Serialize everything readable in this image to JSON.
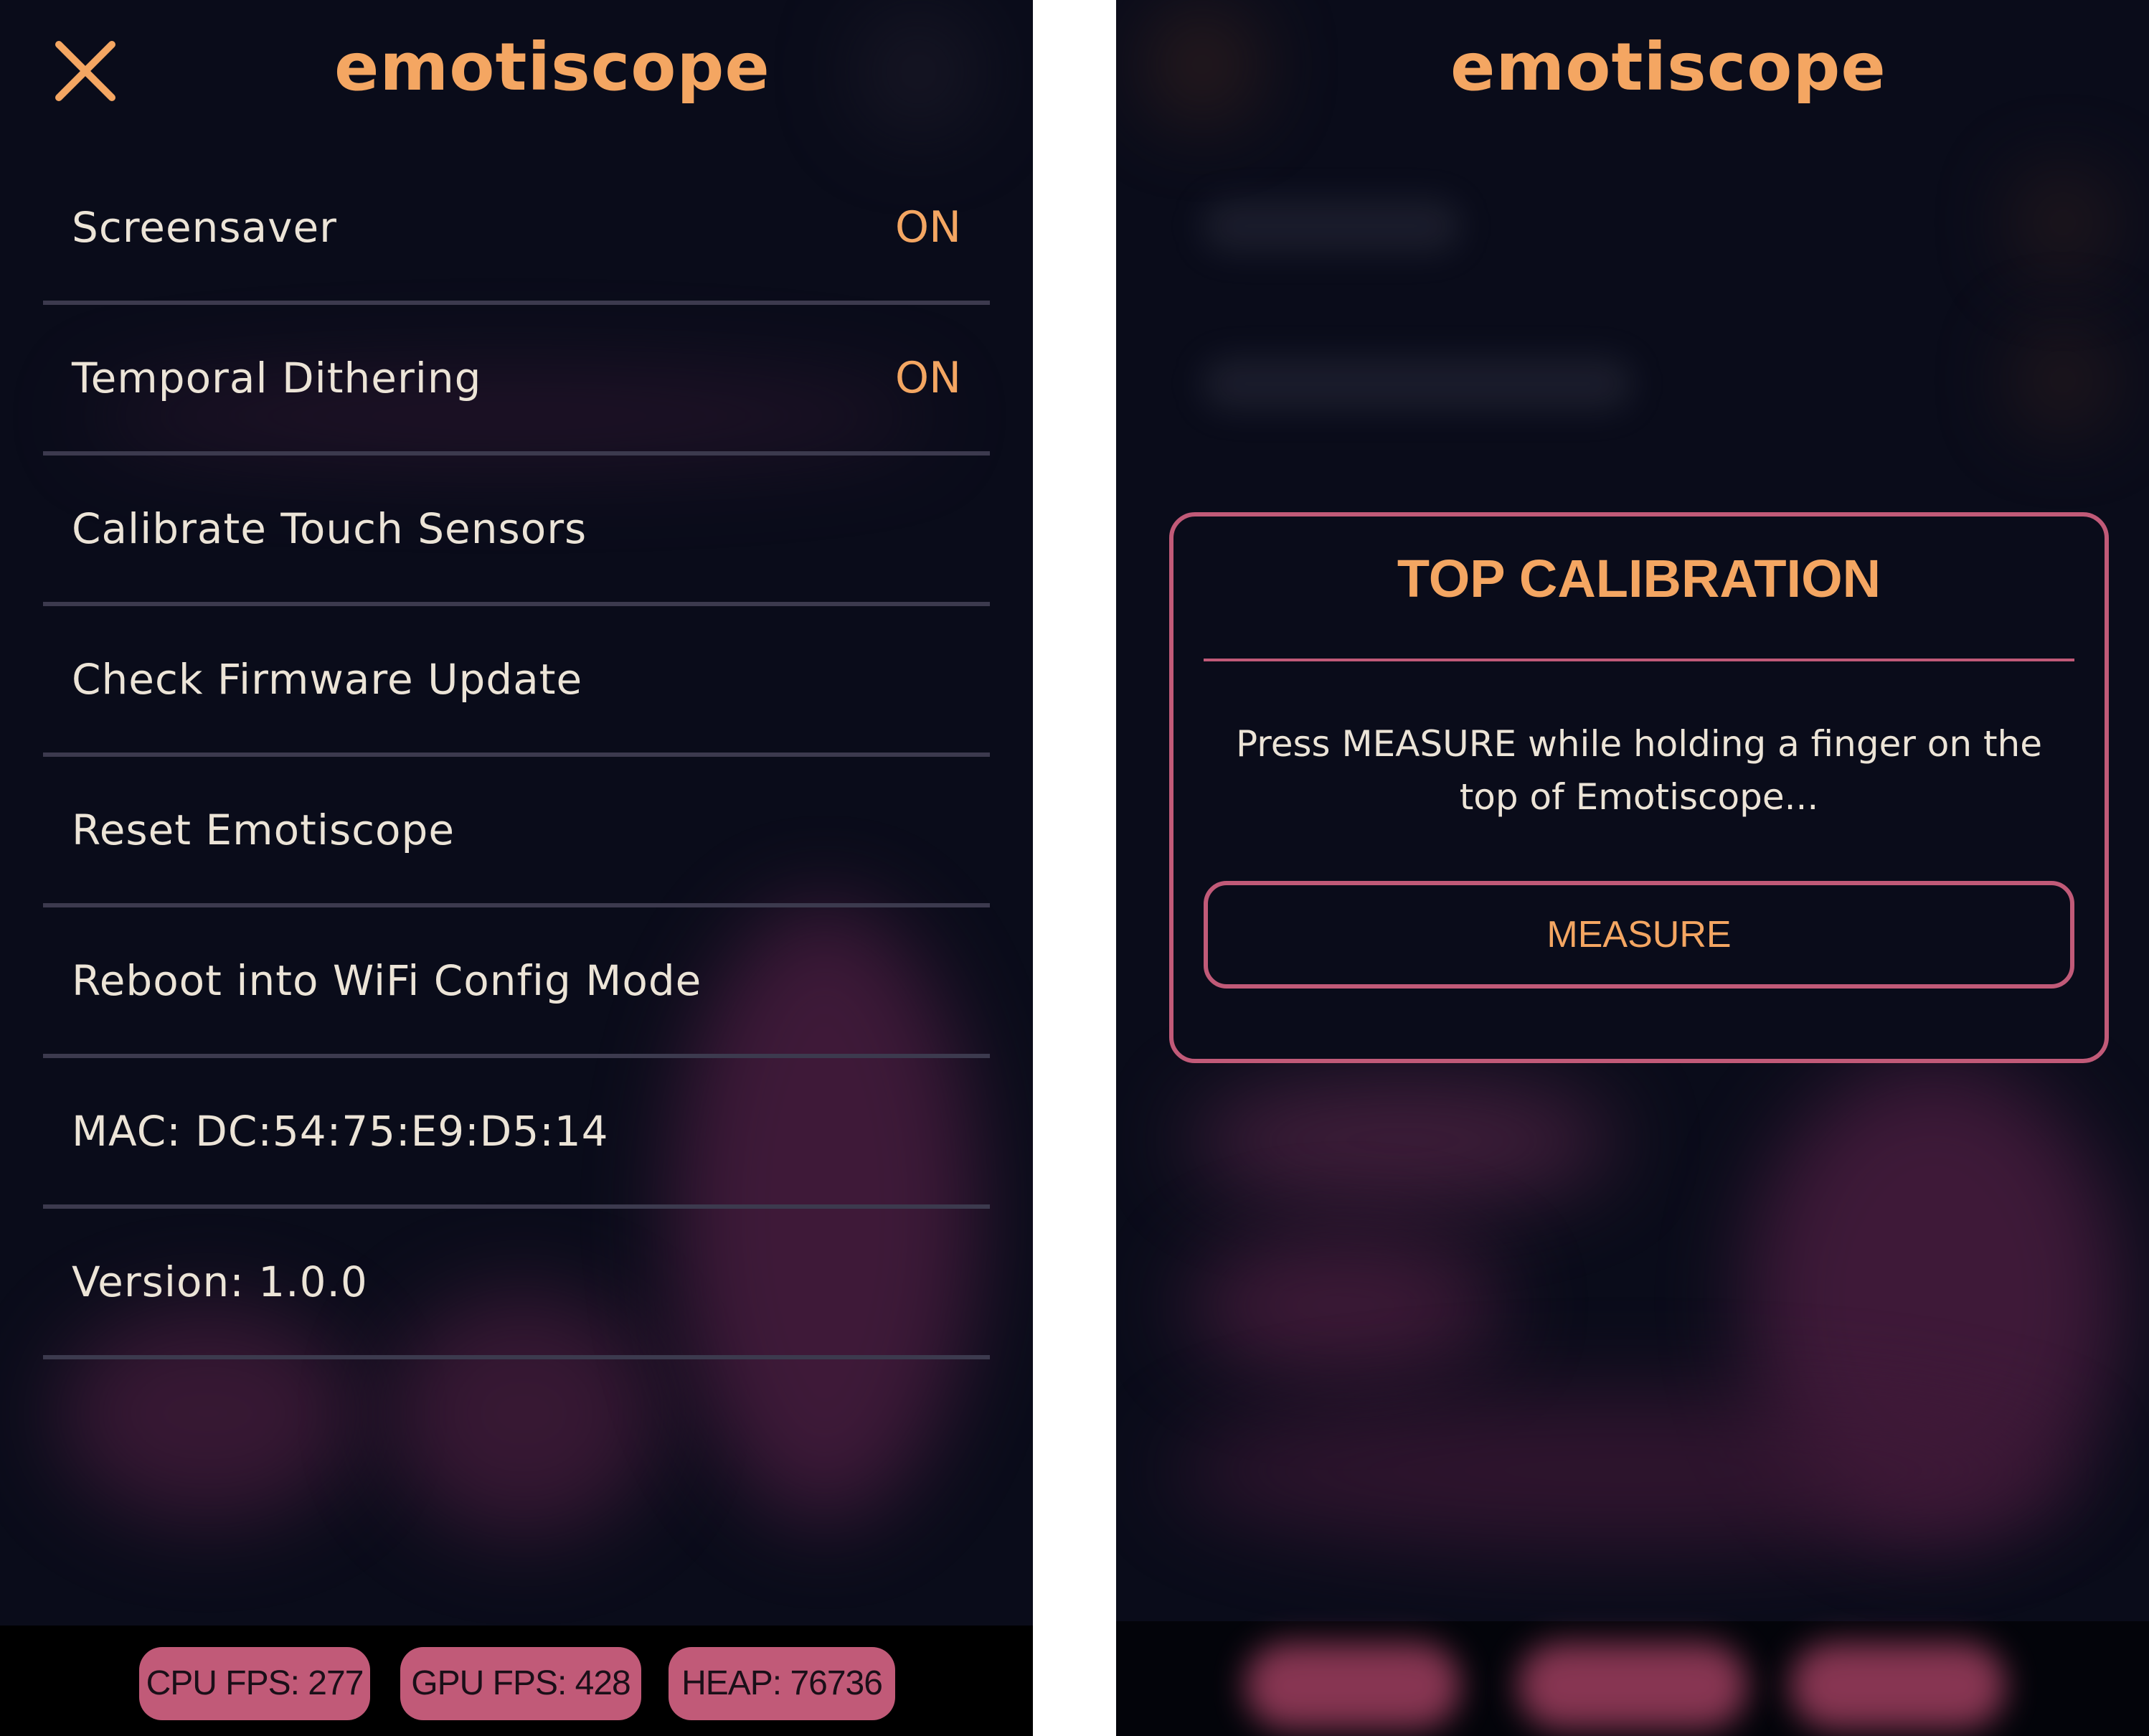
{
  "settings_screen": {
    "app_title": "emotiscope",
    "close_icon": "close-x-icon",
    "menu_items": [
      {
        "label": "Screensaver",
        "value": "ON"
      },
      {
        "label": "Temporal Dithering",
        "value": "ON"
      },
      {
        "label": "Calibrate Touch Sensors"
      },
      {
        "label": "Check Firmware Update"
      },
      {
        "label": "Reset Emotiscope"
      },
      {
        "label": "Reboot into WiFi Config Mode"
      },
      {
        "label": "MAC: DC:54:75:E9:D5:14"
      },
      {
        "label": "Version: 1.0.0"
      }
    ],
    "stats": {
      "cpu_fps": "CPU FPS: 277",
      "gpu_fps": "GPU FPS: 428",
      "heap": "HEAP: 76736"
    }
  },
  "calibration_screen": {
    "app_title": "emotiscope",
    "modal": {
      "title": "TOP CALIBRATION",
      "body": "Press MEASURE while holding a finger on the top of Emotiscope...",
      "button_label": "MEASURE"
    }
  },
  "colors": {
    "background": "#0a0c1a",
    "accent": "#f4a662",
    "pink": "#c15a78",
    "text": "#ece4d7",
    "divider": "#3c3a4e"
  }
}
